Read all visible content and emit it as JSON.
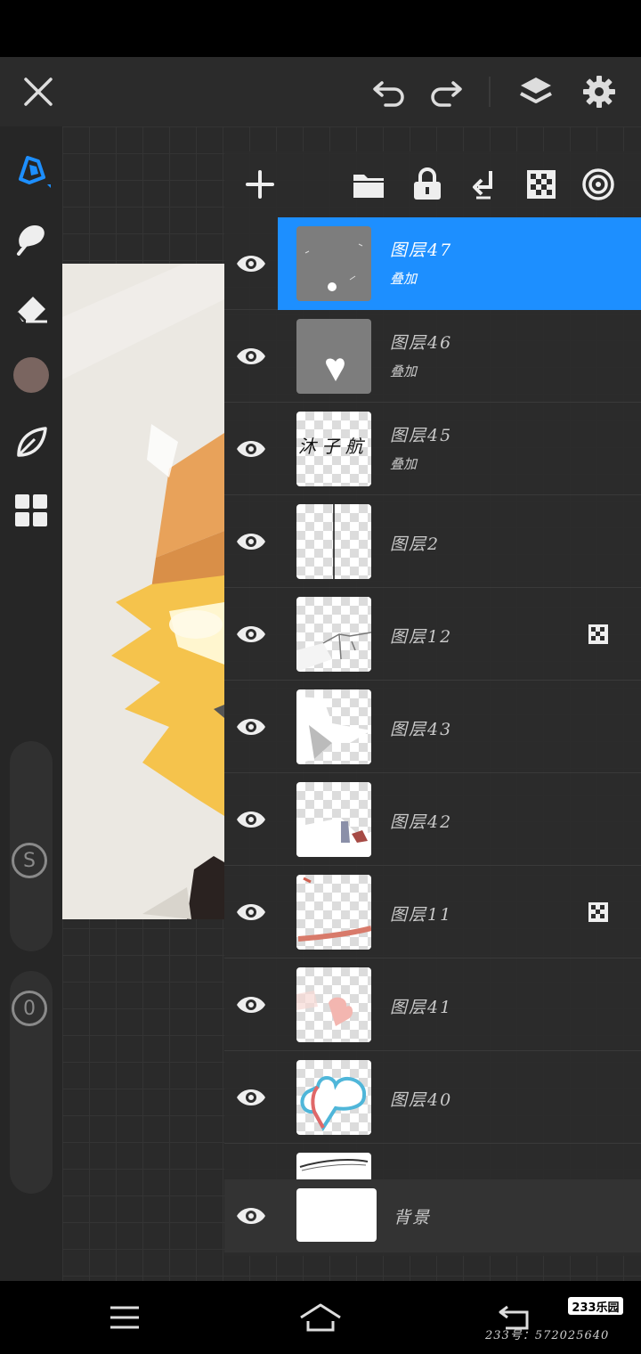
{
  "colors": {
    "accent": "#1d8fff",
    "panel": "#2c2c2c",
    "toolbar": "#262626"
  },
  "top_bar": {
    "icons": [
      "close-icon",
      "undo-icon",
      "redo-icon",
      "layers-icon",
      "gear-icon"
    ]
  },
  "left_toolbar": {
    "tools": [
      "brush-icon",
      "smudge-icon",
      "eraser-icon",
      "color-swatch",
      "leaf-icon",
      "grid-icon"
    ],
    "size_slider_label": "S",
    "opacity_slider_label": "0",
    "current_color": "#7a6560"
  },
  "layer_panel": {
    "toolbar_icons": [
      "add-layer-icon",
      "folder-icon",
      "lock-icon",
      "merge-down-icon",
      "checker-icon",
      "target-icon"
    ],
    "layers": [
      {
        "name": "图层47",
        "blend": "叠加",
        "selected": true,
        "clipped": false
      },
      {
        "name": "图层46",
        "blend": "叠加",
        "selected": false,
        "clipped": false
      },
      {
        "name": "图层45",
        "blend": "叠加",
        "selected": false,
        "clipped": false
      },
      {
        "name": "图层2",
        "blend": "",
        "selected": false,
        "clipped": false
      },
      {
        "name": "图层12",
        "blend": "",
        "selected": false,
        "clipped": true
      },
      {
        "name": "图层43",
        "blend": "",
        "selected": false,
        "clipped": false
      },
      {
        "name": "图层42",
        "blend": "",
        "selected": false,
        "clipped": false
      },
      {
        "name": "图层11",
        "blend": "",
        "selected": false,
        "clipped": true
      },
      {
        "name": "图层41",
        "blend": "",
        "selected": false,
        "clipped": false
      },
      {
        "name": "图层40",
        "blend": "",
        "selected": false,
        "clipped": false
      }
    ],
    "thumb45_text": "沐 子 航",
    "background_layer": {
      "name": "背景"
    }
  },
  "bottom_nav": {
    "icons": [
      "menu-icon",
      "home-icon",
      "back-icon"
    ],
    "logo": "233乐园",
    "watermark": "233号：572025640"
  }
}
